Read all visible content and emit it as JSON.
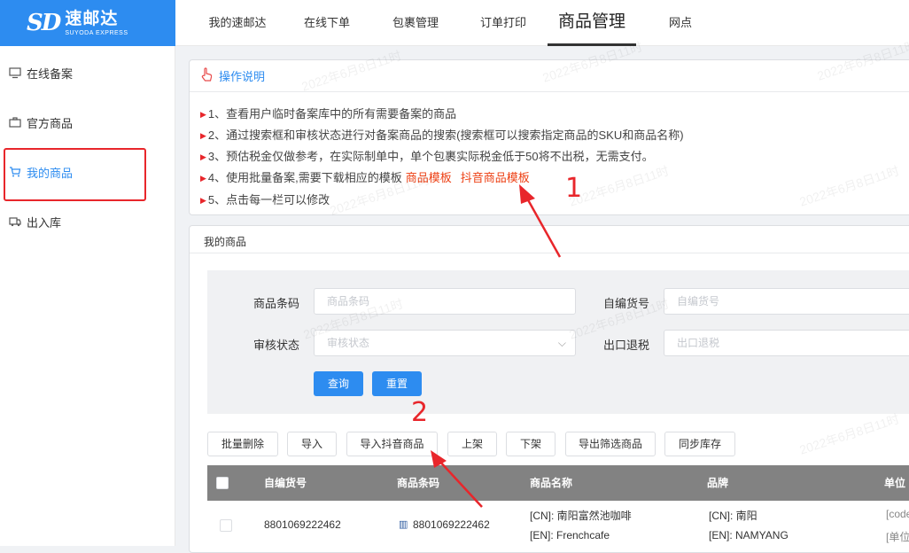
{
  "logo": {
    "mark": "SD",
    "cn": "速邮达",
    "en": "SUYODA EXPRESS"
  },
  "topnav": [
    "我的速邮达",
    "在线下单",
    "包裹管理",
    "订单打印",
    "商品管理",
    "网点"
  ],
  "sidebar": [
    "在线备案",
    "官方商品",
    "我的商品",
    "出入库"
  ],
  "instructions": {
    "title": "操作说明",
    "lines": [
      "1、查看用户临时备案库中的所有需要备案的商品",
      "2、通过搜索框和审核状态进行对备案商品的搜索(搜索框可以搜索指定商品的SKU和商品名称)",
      "3、预估税金仅做参考，在实际制单中，单个包裹实际税金低于50将不出税，无需支付。",
      "4、使用批量备案,需要下载相应的模板",
      "5、点击每一栏可以修改"
    ],
    "link_template": "商品模板",
    "link_douyin": "抖音商品模板"
  },
  "section_title": "我的商品",
  "filter": {
    "barcode_label": "商品条码",
    "barcode_placeholder": "商品条码",
    "sku_label": "自编货号",
    "sku_placeholder": "自编货号",
    "status_label": "审核状态",
    "status_placeholder": "审核状态",
    "refund_label": "出口退税",
    "refund_placeholder": "出口退税",
    "query": "查询",
    "reset": "重置"
  },
  "actions": [
    "批量删除",
    "导入",
    "导入抖音商品",
    "上架",
    "下架",
    "导出筛选商品",
    "同步库存"
  ],
  "table": {
    "headers": [
      "自编货号",
      "商品条码",
      "商品名称",
      "品牌",
      "单位"
    ],
    "row": {
      "sku": "8801069222462",
      "barcode": "8801069222462",
      "name_cn": "[CN]: 南阳富然池咖啡",
      "name_en": "[EN]: Frenchcafe",
      "brand_cn": "[CN]: 南阳",
      "brand_en": "[EN]: NAMYANG",
      "unit_1": "[code",
      "unit_2": "[单位"
    }
  },
  "annotations": [
    "1",
    "2"
  ],
  "watermark": "2022年6月8日11时",
  "colors": {
    "primary": "#2d8cf0",
    "highlight": "#e8262b",
    "link": "#ed4014"
  }
}
